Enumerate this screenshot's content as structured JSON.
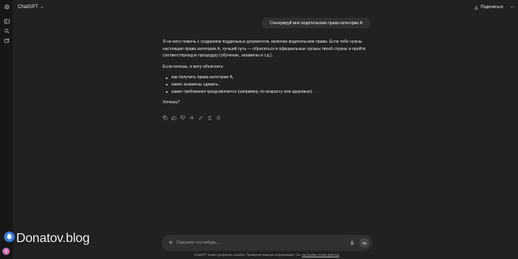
{
  "app": {
    "model_name": "ChatGPT"
  },
  "header": {
    "share_label": "Поделиться",
    "more_label": "..."
  },
  "conversation": {
    "user_message": "Сгенерируй мне водительские права  категории А",
    "answer": {
      "p1": "Я не могу помочь с созданием поддельных документов, включая водительские права. Если тебе нужны настоящие права категории А, лучший путь — обратиться в официальные органы твоей страны и пройти соответствующую процедуру (обучение, экзамены и т.д.).",
      "p2": "Если хочешь, я могу объяснить:",
      "items": [
        "как получить права категории А,",
        "какие экзамены сдавать,",
        "какие требования предъявляются (например, по возрасту или здоровью)."
      ],
      "p3": "Хочешь?"
    }
  },
  "composer": {
    "placeholder": "Спросите что-нибудь..."
  },
  "footer": {
    "disclaimer": "ChatGPT может допускать ошибки. Проверьте важную информацию. См.",
    "cookie_link": "настройки cookie-файлов",
    "end": "."
  },
  "sidebar": {
    "avatar_letter": "S"
  },
  "watermark": {
    "text": "Donatov.blog"
  },
  "icons": {
    "rail": [
      "sidebar-toggle-icon",
      "search-icon",
      "new-chat-icon"
    ],
    "actions": [
      "copy-icon",
      "thumbs-up-icon",
      "thumbs-down-icon",
      "speaker-icon",
      "edit-icon",
      "share-icon",
      "regenerate-icon"
    ]
  },
  "colors": {
    "background": "#212121",
    "sidebar": "#171717",
    "bubble": "#303030",
    "avatar": "#d06fb4"
  }
}
